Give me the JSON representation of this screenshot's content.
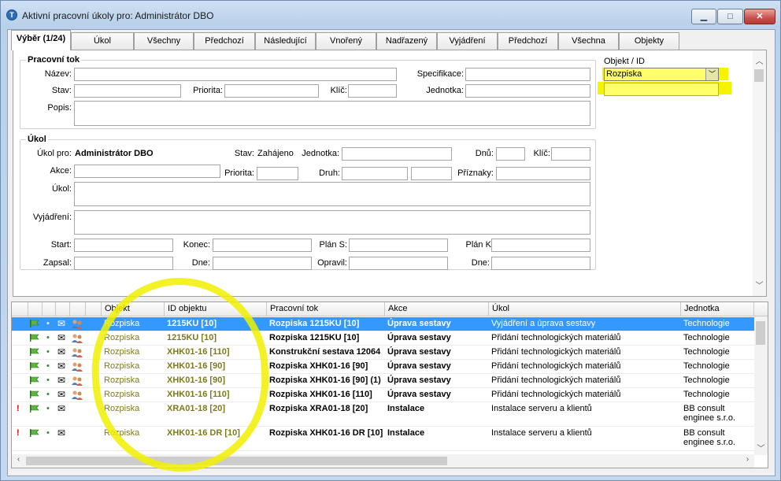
{
  "window": {
    "title": "Aktivní pracovní úkoly pro: Administrátor DBO",
    "icon": "app-logo-icon"
  },
  "tabs": [
    "Výběr (1/24)",
    "Úkol",
    "Všechny",
    "Předchozí",
    "Následující",
    "Vnořený",
    "Nadřazený",
    "Vyjádření",
    "Předchozí",
    "Všechna",
    "Objekty"
  ],
  "workflow_group": {
    "title": "Pracovní tok",
    "labels": {
      "nazev": "Název:",
      "specifikace": "Specifikace:",
      "stav": "Stav:",
      "priorita": "Priorita:",
      "klic": "Klíč:",
      "jednotka": "Jednotka:",
      "popis": "Popis:"
    }
  },
  "object_id": {
    "label": "Objekt / ID",
    "selected": "Rozpiska",
    "id_value": ""
  },
  "task_group": {
    "title": "Úkol",
    "labels": {
      "ukol_pro": "Úkol pro:",
      "stav": "Stav:",
      "jednotka": "Jednotka:",
      "dnu": "Dnů:",
      "klic": "Klíč:",
      "akce": "Akce:",
      "priorita": "Priorita:",
      "druh": "Druh:",
      "priznaky": "Příznaky:",
      "ukol": "Úkol:",
      "vyjadreni": "Vyjádření:",
      "start": "Start:",
      "konec": "Konec:",
      "plan_s": "Plán S:",
      "plan_k": "Plán K:",
      "zapsal": "Zapsal:",
      "dne": "Dne:",
      "opravil": "Opravil:",
      "dne2": "Dne:"
    },
    "ukol_pro_value": "Administrátor DBO",
    "stav_value": "Zahájeno"
  },
  "grid": {
    "columns": [
      "Objekt",
      "ID objektu",
      "Pracovní tok",
      "Akce",
      "Úkol",
      "Jednotka"
    ],
    "rows": [
      {
        "urgent": false,
        "objekt": "Rozpiska",
        "id": "1215KU [10]",
        "tok": "Rozpiska 1215KU [10]",
        "akce": "Úprava sestavy",
        "ukol": "Vyjádření a úprava sestavy",
        "jednotka": "Technologie",
        "users": true,
        "selected": true
      },
      {
        "urgent": false,
        "objekt": "Rozpiska",
        "id": "1215KU [10]",
        "tok": "Rozpiska 1215KU [10]",
        "akce": "Úprava sestavy",
        "ukol": "Přidání technologických materiálů",
        "jednotka": "Technologie",
        "users": true
      },
      {
        "urgent": false,
        "objekt": "Rozpiska",
        "id": "XHK01-16 [110]",
        "tok": "Konstrukční sestava 12064",
        "akce": "Úprava sestavy",
        "ukol": "Přidání technologických materiálů",
        "jednotka": "Technologie",
        "users": true
      },
      {
        "urgent": false,
        "objekt": "Rozpiska",
        "id": "XHK01-16 [90]",
        "tok": "Rozpiska XHK01-16 [90]",
        "akce": "Úprava sestavy",
        "ukol": "Přidání technologických materiálů",
        "jednotka": "Technologie",
        "users": true
      },
      {
        "urgent": false,
        "objekt": "Rozpiska",
        "id": "XHK01-16 [90]",
        "tok": "Rozpiska XHK01-16 [90] (1)",
        "akce": "Úprava sestavy",
        "ukol": "Přidání technologických materiálů",
        "jednotka": "Technologie",
        "users": true
      },
      {
        "urgent": false,
        "objekt": "Rozpiska",
        "id": "XHK01-16 [110]",
        "tok": "Rozpiska XHK01-16 [110]",
        "akce": "Úprava sestavy",
        "ukol": "Přidání technologických materiálů",
        "jednotka": "Technologie",
        "users": true
      },
      {
        "urgent": true,
        "objekt": "Rozpiska",
        "id": "XRA01-18 [20]",
        "tok": "Rozpiska XRA01-18 [20]",
        "akce": "Instalace",
        "ukol": "Instalace serveru a klientů",
        "jednotka": "BB consult enginee s.r.o.",
        "users": false
      },
      {
        "urgent": true,
        "objekt": "Rozpiska",
        "id": "XHK01-16 DR [10]",
        "tok": "Rozpiska XHK01-16 DR [10]",
        "akce": "Instalace",
        "ukol": "Instalace serveru a klientů",
        "jednotka": "BB consult enginee s.r.o.",
        "users": false
      }
    ]
  },
  "icons": {
    "urgent": "!",
    "dot": "•",
    "mail": "✉"
  }
}
